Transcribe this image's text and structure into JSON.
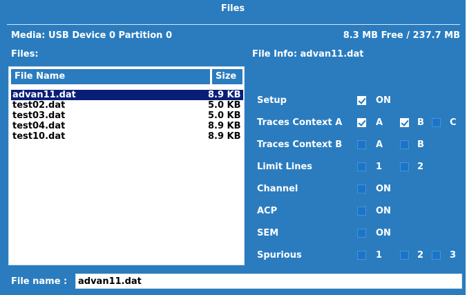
{
  "window": {
    "title": "Files"
  },
  "media": {
    "label": "Media: USB Device 0 Partition 0",
    "free_space": "8.3 MB Free / 237.7 MB"
  },
  "files_label": "Files:",
  "file_info_label": "File Info: advan11.dat",
  "file_list": {
    "columns": [
      "File Name",
      "Size"
    ],
    "rows": [
      {
        "name": "advan11.dat",
        "size": "8.9 KB",
        "selected": true
      },
      {
        "name": "test02.dat",
        "size": "5.0 KB",
        "selected": false
      },
      {
        "name": "test03.dat",
        "size": "5.0 KB",
        "selected": false
      },
      {
        "name": "test04.dat",
        "size": "8.9 KB",
        "selected": false
      },
      {
        "name": "test10.dat",
        "size": "8.9 KB",
        "selected": false
      }
    ]
  },
  "options": [
    {
      "label": "Setup",
      "checks": [
        {
          "label": "ON",
          "checked": true
        }
      ]
    },
    {
      "label": "Traces Context A",
      "checks": [
        {
          "label": "A",
          "checked": true
        },
        {
          "label": "B",
          "checked": true
        },
        {
          "label": "C",
          "checked": false
        }
      ]
    },
    {
      "label": "Traces Context B",
      "checks": [
        {
          "label": "A",
          "checked": false
        },
        {
          "label": "B",
          "checked": false
        }
      ]
    },
    {
      "label": "Limit Lines",
      "checks": [
        {
          "label": "1",
          "checked": false
        },
        {
          "label": "2",
          "checked": false
        }
      ]
    },
    {
      "label": "Channel",
      "checks": [
        {
          "label": "ON",
          "checked": false
        }
      ]
    },
    {
      "label": "ACP",
      "checks": [
        {
          "label": "ON",
          "checked": false
        }
      ]
    },
    {
      "label": "SEM",
      "checks": [
        {
          "label": "ON",
          "checked": false
        }
      ]
    },
    {
      "label": "Spurious",
      "checks": [
        {
          "label": "1",
          "checked": false
        },
        {
          "label": "2",
          "checked": false
        },
        {
          "label": "3",
          "checked": false
        }
      ]
    }
  ],
  "filename": {
    "label": "File name :",
    "value": "advan11.dat"
  },
  "colors": {
    "background": "#2a7cbf",
    "selection": "#0a1e78",
    "checkbox": "#1a75c8"
  }
}
